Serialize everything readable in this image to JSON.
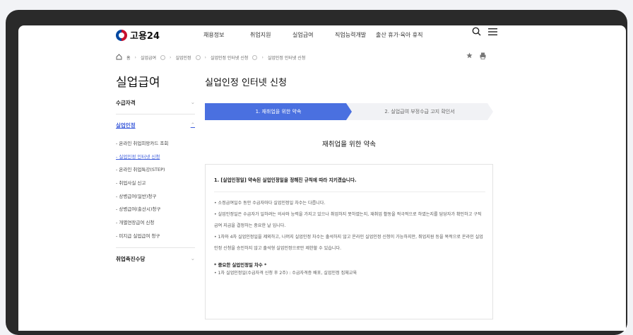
{
  "header": {
    "logo_text": "고용24",
    "nav": [
      "채용정보",
      "취업지원",
      "실업급여",
      "직업능력개발",
      "출산 휴가·육아 휴직"
    ],
    "search_glyph": "⚲",
    "menu_glyph": "☰"
  },
  "breadcrumb": {
    "home": "홈",
    "items": [
      "실업급여",
      "실업인정",
      "실업인정 인터넷 신청",
      "실업인정 인터넷 신청"
    ],
    "star_glyph": "★",
    "print_glyph": "🖶"
  },
  "sidebar": {
    "title": "실업급여",
    "sections": [
      {
        "label": "수급자격"
      },
      {
        "label": "실업인정",
        "items": [
          "온라인 취업희망카드 조회",
          "실업인정 인터넷 신청",
          "온라인 취업특강(STEP)",
          "취업사실 신고",
          "상병급여(일반)청구",
          "상병급여(출산시)청구",
          "개별연장급여 신청",
          "미지급 실업급여 청구"
        ]
      },
      {
        "label": "취업촉진수당"
      }
    ]
  },
  "main": {
    "page_title": "실업인정 인터넷 신청",
    "steps": [
      "1. 재취업을 위한 약속",
      "2. 실업급여 부정수급 고지 확인서"
    ],
    "sub_heading": "재취업을 위한 약속",
    "notice": {
      "heading": "1. [실업인정일] 약속된 실업인정일을 정해진 규칙에 따라 지키겠습니다.",
      "bullets": [
        "소정급여일수 동안 수급자마다 실업인정일 차수는 다릅니다.",
        "실업인정일은 수급자가 일하려는 의사와 능력을 가지고 있으나 취업하지 못하였는지, 재취업 활동을 적극적으로 하였는지를 담당자가 확인하고 구직급여 지급을 결정하는 중요한 날 입니다.",
        "1차와 4차 실업인정일을 제외하고, 나머지 실업인정 차수는 출석하지 않고 온라인 실업인정 신청이 가능하지만, 취업지원 등을 목적으로 온라인 실업인정 신청을 승인하지 않고 출석형 실업인정으로만 제한할 수 있습니다."
      ],
      "important_title": "* 중요한 실업인정일 차수 *",
      "important_items": [
        "1차 실업인정일(수급자격 신청 후 2주) : 수급자격증 배포, 실업인정 집체교육"
      ]
    }
  }
}
